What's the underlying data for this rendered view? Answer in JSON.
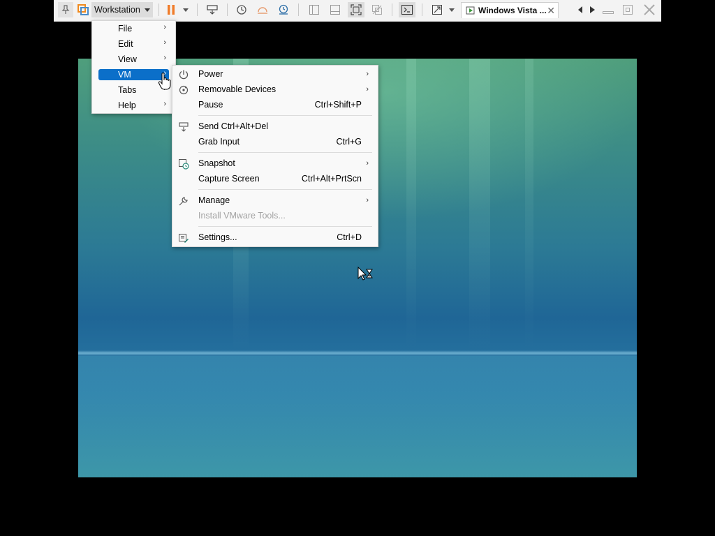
{
  "toolbar": {
    "workstation_label": "Workstation",
    "vm_tab_label": "Windows Vista ...",
    "vm_tab_close": "✕"
  },
  "main_menu": {
    "items": [
      {
        "label": "File",
        "arrow": "›"
      },
      {
        "label": "Edit",
        "arrow": "›"
      },
      {
        "label": "View",
        "arrow": "›"
      },
      {
        "label": "VM",
        "arrow": "›",
        "selected": true
      },
      {
        "label": "Tabs",
        "arrow": "›"
      },
      {
        "label": "Help",
        "arrow": "›"
      }
    ]
  },
  "vm_menu": {
    "items": [
      {
        "label": "Power",
        "shortcut": "",
        "arrow": "›",
        "icon": "power-icon"
      },
      {
        "label": "Removable Devices",
        "shortcut": "",
        "arrow": "›",
        "icon": "removable-devices-icon"
      },
      {
        "label": "Pause",
        "shortcut": "Ctrl+Shift+P",
        "arrow": ""
      },
      {
        "label": "Send Ctrl+Alt+Del",
        "shortcut": "",
        "arrow": "",
        "icon": "send-cad-icon"
      },
      {
        "label": "Grab Input",
        "shortcut": "Ctrl+G",
        "arrow": ""
      },
      {
        "label": "Snapshot",
        "shortcut": "",
        "arrow": "›",
        "icon": "snapshot-icon"
      },
      {
        "label": "Capture Screen",
        "shortcut": "Ctrl+Alt+PrtScn",
        "arrow": ""
      },
      {
        "label": "Manage",
        "shortcut": "",
        "arrow": "›",
        "icon": "wrench-icon"
      },
      {
        "label": "Install VMware Tools...",
        "shortcut": "",
        "arrow": "",
        "disabled": true
      },
      {
        "label": "Settings...",
        "shortcut": "Ctrl+D",
        "arrow": "",
        "icon": "settings-icon"
      }
    ]
  },
  "colors": {
    "menu_highlight": "#0b6fc9",
    "pause_accent": "#f07c2a",
    "disabled_text": "#a2a2a2"
  }
}
